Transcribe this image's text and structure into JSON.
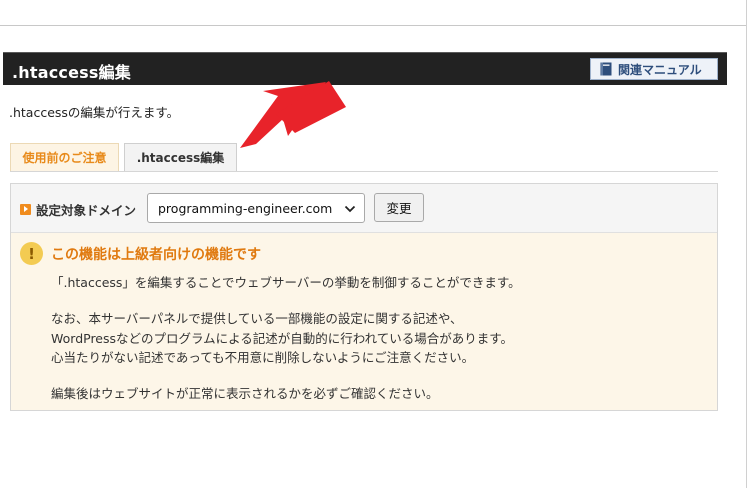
{
  "header": {
    "title": ".htaccess編集",
    "manual_button": "関連マニュアル",
    "manual_icon": "book-icon"
  },
  "description": ".htaccessの編集が行えます。",
  "tabs": [
    {
      "label": "使用前のご注意",
      "active": true
    },
    {
      "label": ".htaccess編集",
      "active": false
    }
  ],
  "domain": {
    "label": "設定対象ドメイン",
    "selected": "programming-engineer.com",
    "change_button": "変更"
  },
  "warning": {
    "icon": "exclamation-icon",
    "title": "この機能は上級者向けの機能です",
    "lines": [
      "「.htaccess」を編集することでウェブサーバーの挙動を制御することができます。",
      "なお、本サーバーパネルで提供している一部機能の設定に関する記述や、",
      "WordPressなどのプログラムによる記述が自動的に行われている場合があります。",
      "心当たりがない記述であっても不用意に削除しないようにご注意ください。",
      "編集後はウェブサイトが正常に表示されるかを必ずご確認ください。"
    ]
  },
  "colors": {
    "accent": "#e88a1a",
    "arrow": "#e8232a",
    "header_bg": "#222222"
  }
}
